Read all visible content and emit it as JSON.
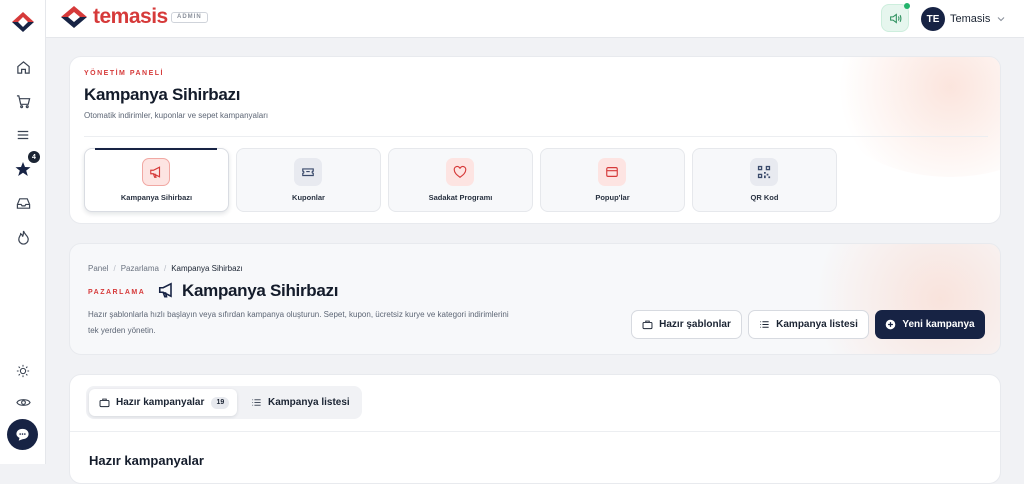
{
  "brand": {
    "name": "temasis",
    "admin_tag": "ADMIN"
  },
  "colors": {
    "brand_red": "#d63a3a",
    "navy": "#172344",
    "green": "#22b36b"
  },
  "sidebar": {
    "items": [
      {
        "icon": "home-icon"
      },
      {
        "icon": "cart-icon"
      },
      {
        "icon": "menu-icon"
      },
      {
        "icon": "star-icon",
        "badge": "4"
      },
      {
        "icon": "inbox-icon"
      },
      {
        "icon": "flame-icon"
      }
    ],
    "bottom": [
      {
        "icon": "sun-icon"
      },
      {
        "icon": "eye-icon"
      },
      {
        "icon": "chat-icon"
      }
    ]
  },
  "header": {
    "user_initials": "TE",
    "user_name": "Temasis"
  },
  "panel": {
    "eyebrow": "YÖNETİM PANELİ",
    "title": "Kampanya Sihirbazı",
    "subtitle": "Otomatik indirimler, kuponlar ve sepet kampanyaları",
    "tiles": [
      {
        "label": "Kampanya Sihirbazı",
        "icon": "megaphone-icon",
        "active": true
      },
      {
        "label": "Kuponlar",
        "icon": "ticket-icon"
      },
      {
        "label": "Sadakat Programı",
        "icon": "heart-icon"
      },
      {
        "label": "Popup'lar",
        "icon": "popup-icon"
      },
      {
        "label": "QR Kod",
        "icon": "qr-code-icon"
      }
    ]
  },
  "hero": {
    "breadcrumb": [
      "Panel",
      "Pazarlama",
      "Kampanya Sihirbazı"
    ],
    "eyebrow": "PAZARLAMA",
    "title": "Kampanya Sihirbazı",
    "description_line1": "Hazır şablonlarla hızlı başlayın veya sıfırdan kampanya oluşturun. Sepet, kupon, ücretsiz kurye ve kategori indirimlerini",
    "description_line2": "tek yerden yönetin.",
    "buttons": {
      "templates": "Hazır şablonlar",
      "list": "Kampanya listesi",
      "new": "Yeni kampanya"
    }
  },
  "content": {
    "tabs": [
      {
        "label": "Hazır kampanyalar",
        "count": "19"
      },
      {
        "label": "Kampanya listesi"
      }
    ],
    "section_title": "Hazır kampanyalar"
  }
}
